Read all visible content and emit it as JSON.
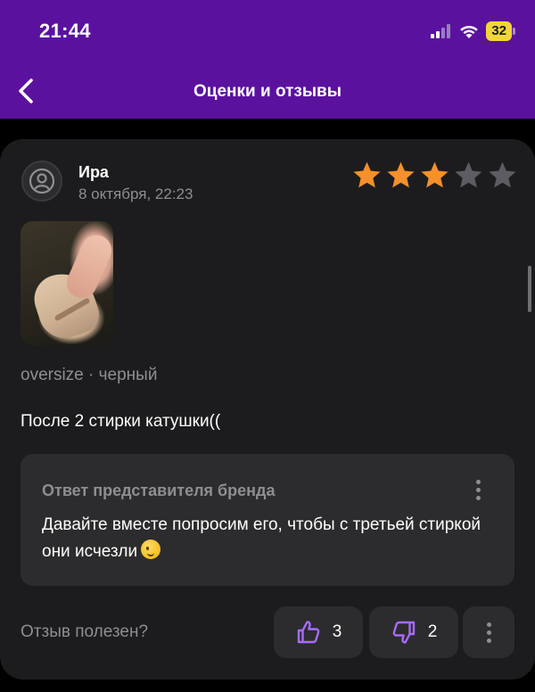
{
  "status_bar": {
    "time": "21:44",
    "battery": "32"
  },
  "header": {
    "title": "Оценки и отзывы"
  },
  "review": {
    "author": "Ира",
    "date": "8 октября, 22:23",
    "rating": 3,
    "max_rating": 5,
    "variant": "oversize · черный",
    "text": "После 2 стирки катушки(("
  },
  "brand_reply": {
    "title": "Ответ представителя бренда",
    "text": "Давайте вместе попросим его, чтобы с третьей стиркой они исчезли"
  },
  "helpful": {
    "label": "Отзыв полезен?",
    "likes": "3",
    "dislikes": "2"
  },
  "colors": {
    "header_bg": "#5a129e",
    "star_filled": "#f5902a",
    "star_empty": "#5c5c61",
    "accent_icon": "#a86bff"
  }
}
